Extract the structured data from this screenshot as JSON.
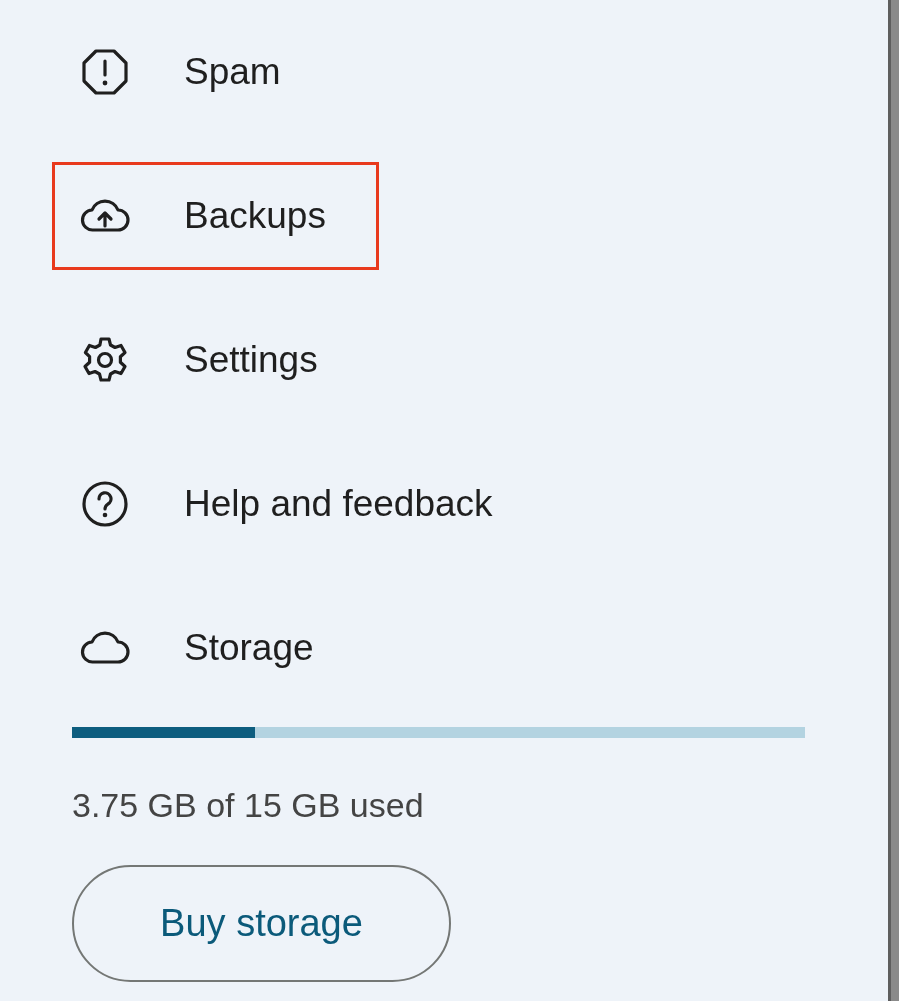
{
  "menu": {
    "items": [
      {
        "kind": "spam",
        "label": "Spam",
        "highlighted": false
      },
      {
        "kind": "backup",
        "label": "Backups",
        "highlighted": true
      },
      {
        "kind": "settings",
        "label": "Settings",
        "highlighted": false
      },
      {
        "kind": "help",
        "label": "Help and feedback",
        "highlighted": false
      },
      {
        "kind": "storage",
        "label": "Storage",
        "highlighted": false
      }
    ]
  },
  "storage": {
    "level": 0.25,
    "usage": "3.75 GB of 15 GB used",
    "button": "Buy storage"
  }
}
